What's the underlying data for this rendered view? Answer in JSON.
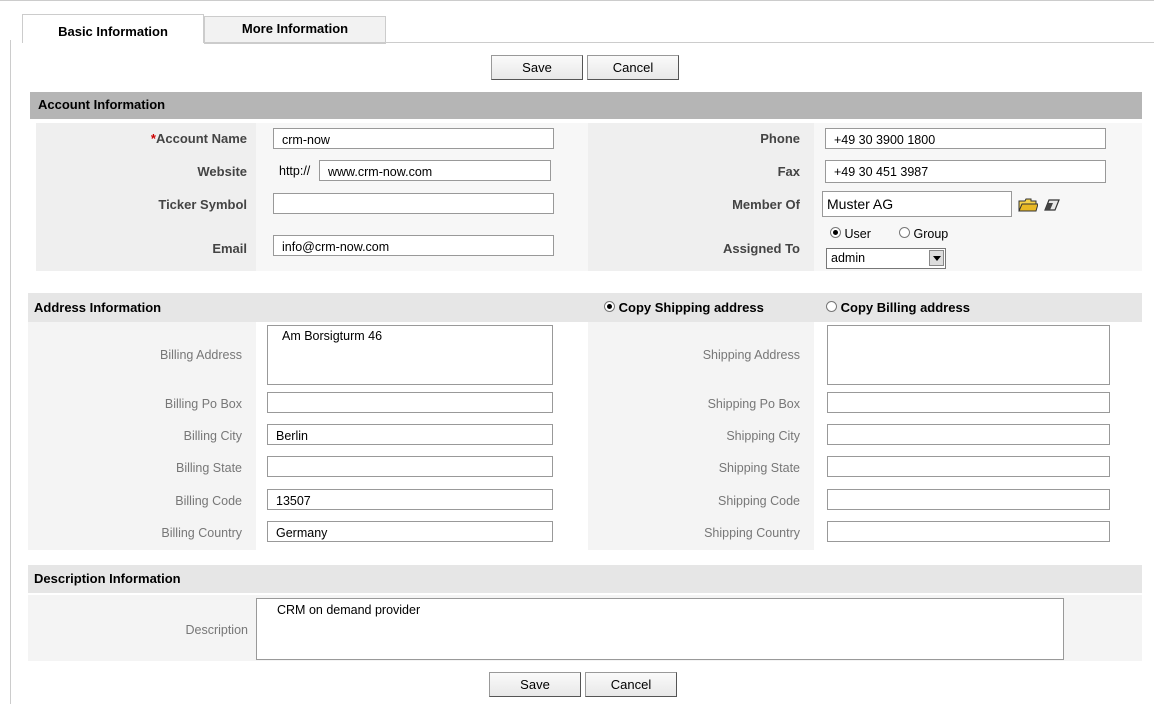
{
  "tabs": [
    {
      "label": "Basic Information"
    },
    {
      "label": "More Information"
    }
  ],
  "buttons": {
    "save": "Save",
    "cancel": "Cancel"
  },
  "account": {
    "header": "Account Information",
    "required_mark": "*",
    "account_name": {
      "label": "Account Name",
      "value": "crm-now"
    },
    "website": {
      "label": "Website",
      "prefix": "http://",
      "value": "www.crm-now.com"
    },
    "ticker_symbol": {
      "label": "Ticker Symbol",
      "value": ""
    },
    "email": {
      "label": "Email",
      "value": "info@crm-now.com"
    },
    "phone": {
      "label": "Phone",
      "value": "+49 30 3900 1800"
    },
    "fax": {
      "label": "Fax",
      "value": "+49 30 451 3987"
    },
    "member_of": {
      "label": "Member Of",
      "value": "Muster AG",
      "select_icon": "folder-icon",
      "clear_icon": "eraser-icon"
    },
    "assigned_to": {
      "label": "Assigned To",
      "option_user": "User",
      "option_group": "Group",
      "selected": "user",
      "value": "admin"
    }
  },
  "address": {
    "header": "Address Information",
    "copy_shipping": "Copy Shipping address",
    "copy_billing": "Copy Billing address",
    "billing": [
      {
        "label": "Billing Address",
        "value": "Am Borsigturm 46"
      },
      {
        "label": "Billing Po Box",
        "value": ""
      },
      {
        "label": "Billing City",
        "value": "Berlin"
      },
      {
        "label": "Billing State",
        "value": ""
      },
      {
        "label": "Billing Code",
        "value": "13507"
      },
      {
        "label": "Billing Country",
        "value": "Germany"
      }
    ],
    "shipping": [
      {
        "label": "Shipping Address",
        "value": ""
      },
      {
        "label": "Shipping Po Box",
        "value": ""
      },
      {
        "label": "Shipping City",
        "value": ""
      },
      {
        "label": "Shipping State",
        "value": ""
      },
      {
        "label": "Shipping Code",
        "value": ""
      },
      {
        "label": "Shipping Country",
        "value": ""
      }
    ]
  },
  "description": {
    "header": "Description Information",
    "label": "Description",
    "value": "CRM on demand provider"
  }
}
